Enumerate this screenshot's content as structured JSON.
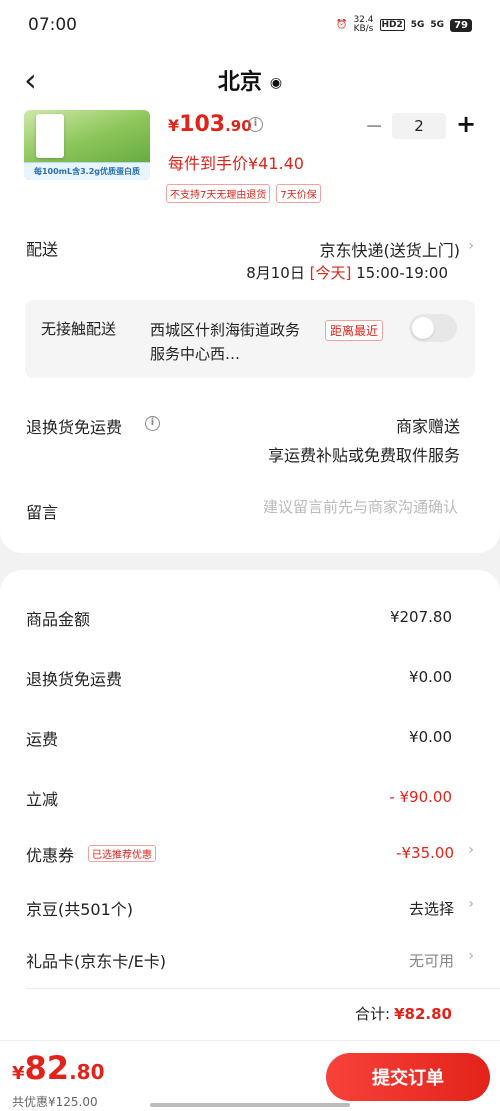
{
  "status": {
    "time": "07:00",
    "net_speed": "32.4\nKB/s",
    "hd": "HD2",
    "sig1": "5G",
    "sig2": "5G",
    "battery": "79"
  },
  "header": {
    "title": "北京"
  },
  "product": {
    "price_symbol": "¥",
    "price_int": "103",
    "price_dec": ".90",
    "quantity": "2",
    "unit_price_text": "每件到手价¥41.40",
    "banner_text": "每100mL含3.2g优质蛋白质",
    "tags": [
      "不支持7天无理由退货",
      "7天价保"
    ]
  },
  "delivery": {
    "label": "配送",
    "method": "京东快递(送货上门)",
    "date": "8月10日",
    "today": "[今天]",
    "window": "15:00-19:00"
  },
  "contactless": {
    "label": "无接触配送",
    "address": "西城区什刹海街道政务服务中心西…",
    "near_tag": "距离最近"
  },
  "returns": {
    "label": "退换货免运费",
    "value": "商家赠送",
    "desc": "享运费补贴或免费取件服务"
  },
  "note": {
    "label": "留言",
    "placeholder": "建议留言前先与商家沟通确认"
  },
  "summary": {
    "items": [
      {
        "key": "商品金额",
        "value": "¥207.80"
      },
      {
        "key": "退换货免运费",
        "value": "¥0.00"
      },
      {
        "key": "运费",
        "value": "¥0.00"
      },
      {
        "key": "立减",
        "value": "- ¥90.00"
      },
      {
        "key": "优惠券",
        "value": "-¥35.00",
        "tag": "已选推荐优惠"
      },
      {
        "key": "京豆(共501个)",
        "value": "去选择"
      },
      {
        "key": "礼品卡(京东卡/E卡)",
        "value": "无可用"
      }
    ],
    "total_label": "合计:",
    "total_value": "¥82.80"
  },
  "footer": {
    "price_symbol": "¥",
    "price_int": "82",
    "price_dec": ".80",
    "saved": "共优惠¥125.00",
    "submit": "提交订单"
  },
  "colors": {
    "accent": "#e2231a"
  }
}
